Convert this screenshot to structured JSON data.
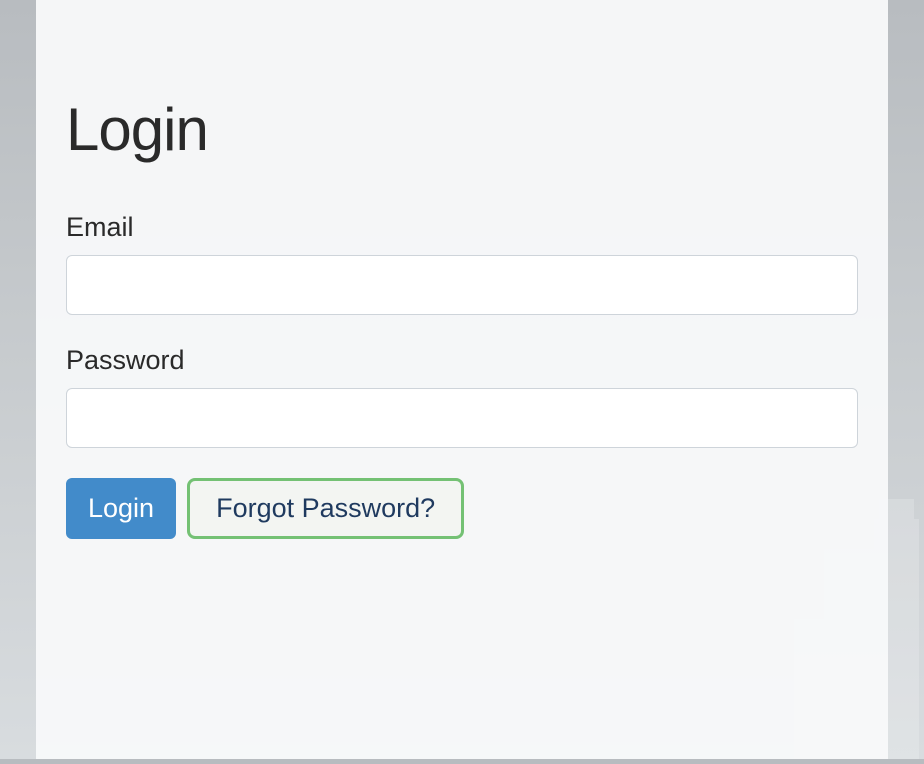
{
  "page": {
    "title": "Login"
  },
  "form": {
    "email": {
      "label": "Email",
      "value": "",
      "placeholder": ""
    },
    "password": {
      "label": "Password",
      "value": "",
      "placeholder": ""
    }
  },
  "buttons": {
    "login": "Login",
    "forgot": "Forgot Password?"
  },
  "colors": {
    "primary": "#428bca",
    "highlight_border": "#74c174",
    "text_dark": "#2a2a2a",
    "link": "#1f3a5f"
  }
}
